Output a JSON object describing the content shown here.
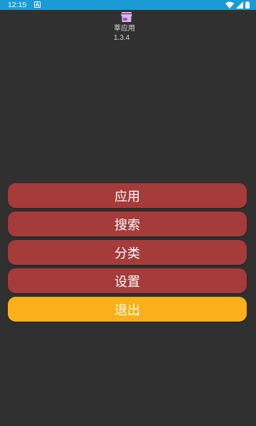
{
  "status_bar": {
    "time": "12:15",
    "background_color": "#1b9bd6",
    "icons": [
      "notification-a-icon",
      "wifi-icon",
      "cellular-signal-icon",
      "battery-icon"
    ]
  },
  "app": {
    "icon": "storefront-icon",
    "name": "莘应用",
    "version": "1.3.4"
  },
  "menu": {
    "apps_label": "应用",
    "search_label": "搜索",
    "categories_label": "分类",
    "settings_label": "设置",
    "exit_label": "退出",
    "button_color": "#a63b3b",
    "exit_color": "#fbb01b"
  },
  "background_color": "#303030"
}
